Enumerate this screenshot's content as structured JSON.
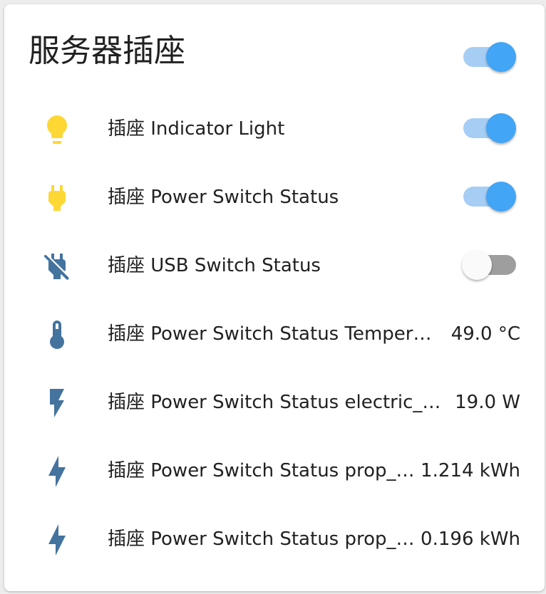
{
  "card": {
    "title": "服务器插座",
    "main_toggle_on": true
  },
  "colors": {
    "active_icon": "#fdd835",
    "inactive_icon": "#44739e",
    "toggle_on_thumb": "#42a5f5",
    "toggle_on_track": "#a6cdf4",
    "toggle_off_track": "#9e9e9e",
    "text": "#212121"
  },
  "rows": [
    {
      "icon": "lightbulb-icon",
      "label": "插座 Indicator Light",
      "toggle_on": true
    },
    {
      "icon": "power-plug-icon",
      "label": "插座 Power Switch Status",
      "toggle_on": true
    },
    {
      "icon": "power-plug-off-icon",
      "label": "插座 USB Switch Status",
      "toggle_on": false
    },
    {
      "icon": "thermometer-icon",
      "label": "插座 Power Switch Status Temperature",
      "value": "49.0 °C"
    },
    {
      "icon": "flash-icon",
      "label": "插座 Power Switch Status electric_power",
      "value": "19.0 W"
    },
    {
      "icon": "flash-icon",
      "label": "插座 Power Switch Status prop_consumption",
      "value": "1.214 kWh"
    },
    {
      "icon": "flash-icon",
      "label": "插座 Power Switch Status prop_consumption",
      "value": "0.196 kWh"
    }
  ]
}
